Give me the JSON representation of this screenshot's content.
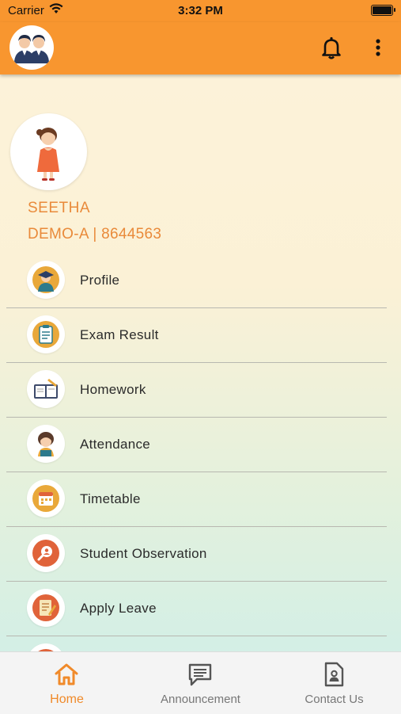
{
  "status_bar": {
    "carrier": "Carrier",
    "time": "3:32 PM"
  },
  "app_bar": {
    "logo": "students-logo",
    "notifications_icon": "bell-icon",
    "menu_icon": "more-vertical-icon"
  },
  "profile": {
    "name": "SEETHA",
    "class_info": "DEMO-A | 8644563",
    "avatar": "girl-student-avatar"
  },
  "menu": {
    "items": [
      {
        "label": "Profile",
        "icon": "graduate-icon"
      },
      {
        "label": "Exam Result",
        "icon": "clipboard-icon"
      },
      {
        "label": "Homework",
        "icon": "homework-icon"
      },
      {
        "label": "Attendance",
        "icon": "student-girl-icon"
      },
      {
        "label": "Timetable",
        "icon": "calendar-icon"
      },
      {
        "label": "Student Observation",
        "icon": "magnifier-user-icon"
      },
      {
        "label": "Apply Leave",
        "icon": "leave-note-icon"
      }
    ]
  },
  "tabs": [
    {
      "label": "Home",
      "icon": "home-icon",
      "active": true
    },
    {
      "label": "Announcement",
      "icon": "message-icon",
      "active": false
    },
    {
      "label": "Contact Us",
      "icon": "contact-doc-icon",
      "active": false
    }
  ],
  "colors": {
    "primary": "#f8962f",
    "accent_text": "#e98a3a",
    "active_tab": "#f08a2a"
  }
}
